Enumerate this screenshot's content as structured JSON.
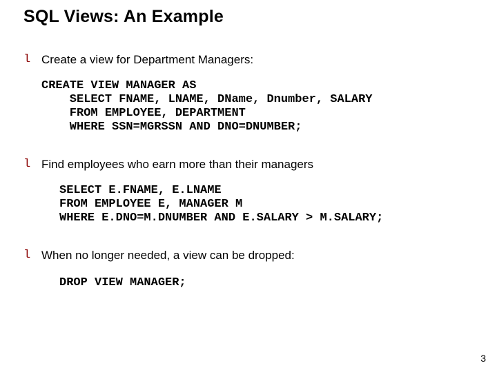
{
  "title": "SQL Views: An Example",
  "bullets": [
    {
      "marker": "l",
      "text": "Create a view for Department Managers:"
    },
    {
      "marker": "l",
      "text": "Find employees who earn more than their managers"
    },
    {
      "marker": "l",
      "text": "When no longer needed, a view can be dropped:"
    }
  ],
  "code": [
    "CREATE VIEW MANAGER AS\n    SELECT FNAME, LNAME, DName, Dnumber, SALARY\n    FROM EMPLOYEE, DEPARTMENT\n    WHERE SSN=MGRSSN AND DNO=DNUMBER;",
    "SELECT E.FNAME, E.LNAME\nFROM EMPLOYEE E, MANAGER M\nWHERE E.DNO=M.DNUMBER AND E.SALARY > M.SALARY;",
    "DROP VIEW MANAGER;"
  ],
  "page_number": "3"
}
